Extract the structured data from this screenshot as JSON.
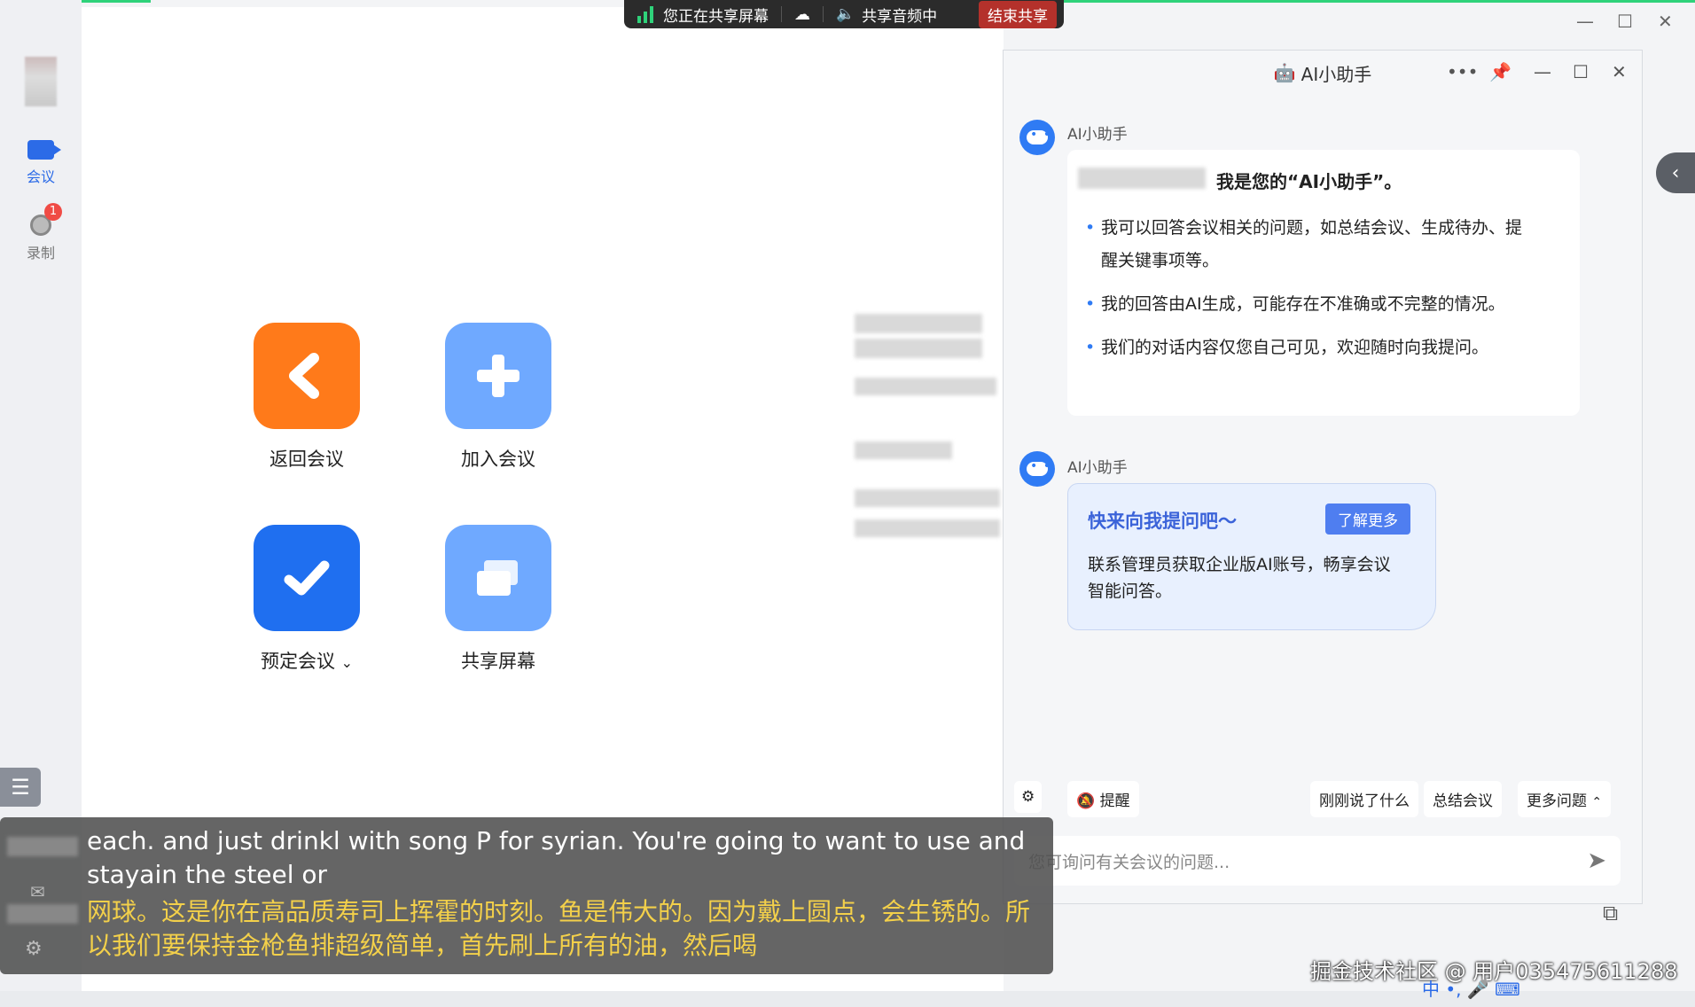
{
  "sharebar": {
    "sharing": "您正在共享屏幕",
    "audio": "共享音频中",
    "stop": "结束共享"
  },
  "sidebar": {
    "items": [
      {
        "label": "会议"
      },
      {
        "label": "录制"
      }
    ],
    "badge": "1"
  },
  "main": {
    "tiles": [
      {
        "label": "返回会议",
        "color": "#ff7a1a"
      },
      {
        "label": "加入会议",
        "color": "#6fa9ff"
      },
      {
        "label": "预定会议",
        "color": "#1f6ff0"
      },
      {
        "label": "共享屏幕",
        "color": "#6fa9ff"
      }
    ],
    "dropdown_glyph": "⌄"
  },
  "ai": {
    "title": "AI小助手",
    "bot_name": "AI小助手",
    "intro": "我是您的“AI小助手”。",
    "bullets": [
      "我可以回答会议相关的问题，如总结会议、生成待办、提醒关键事项等。",
      "我的回答由AI生成，可能存在不准确或不完整的情况。",
      "我们的对话内容仅您自己可见，欢迎随时向我提问。"
    ],
    "promo_title": "快来向我提问吧～",
    "learn_more": "了解更多",
    "promo_text": "联系管理员获取企业版AI账号，畅享会议智能问答。",
    "remind": "提醒",
    "chips": [
      "刚刚说了什么",
      "总结会议",
      "更多问题"
    ],
    "input_placeholder": "您可询问有关会议的问题..."
  },
  "subtitles": {
    "en": "each. and just drinkl with song P for syrian. You're going to want to use and stayain the steel or",
    "zh": "网球。这是你在高品质寿司上挥霍的时刻。鱼是伟大的。因为戴上圆点，会生锈的。所以我们要保持金枪鱼排超级简单，首先刷上所有的油，然后喝"
  },
  "watermark": "掘金技术社区 @ 用户035475611288",
  "ime": "中 •, 🎤 ⌨"
}
